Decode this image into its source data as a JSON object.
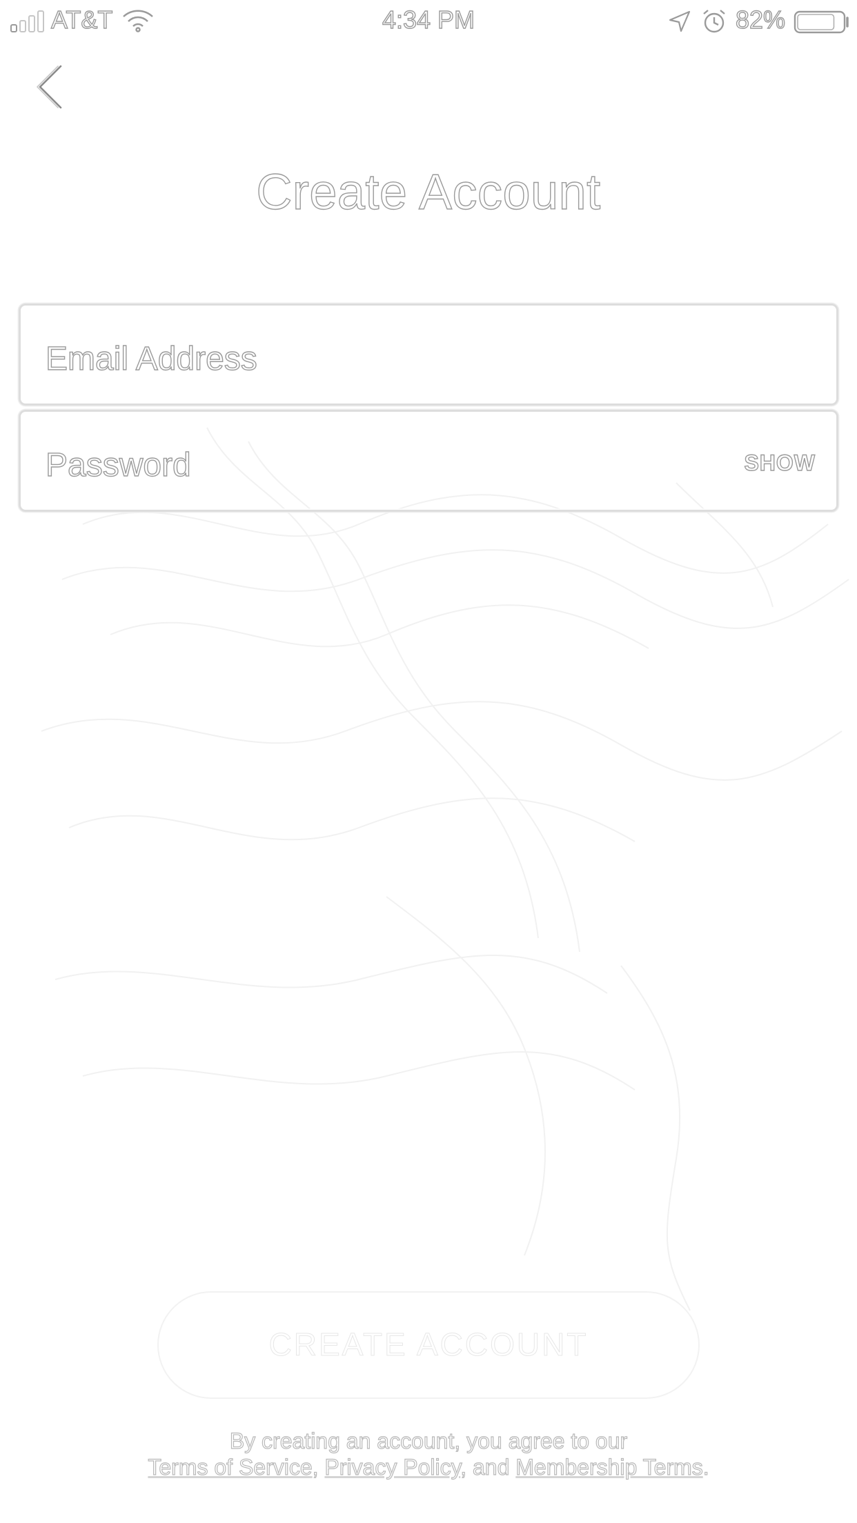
{
  "status_bar": {
    "carrier": "AT&T",
    "time": "4:34 PM",
    "battery_percent": "82%",
    "battery_level": 0.82,
    "icons": [
      "signal-icon",
      "wifi-icon",
      "location-icon",
      "alarm-icon",
      "battery-icon"
    ]
  },
  "header": {
    "back_icon": "chevron-left-icon",
    "title": "Create Account"
  },
  "form": {
    "email": {
      "placeholder": "Email Address",
      "value": ""
    },
    "password": {
      "placeholder": "Password",
      "value": "",
      "show_label": "SHOW"
    }
  },
  "cta": {
    "label": "CREATE ACCOUNT",
    "enabled": false
  },
  "legal": {
    "line1": "By creating an account, you agree to our",
    "terms_link": "Terms of Service",
    "sep1": ", ",
    "privacy_link": "Privacy Policy",
    "sep2": ", and ",
    "membership_link": "Membership Terms",
    "end": "."
  }
}
